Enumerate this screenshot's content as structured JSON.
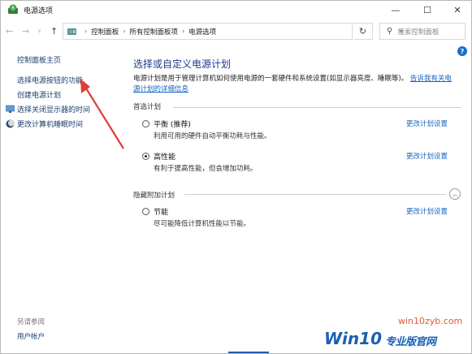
{
  "window": {
    "title": "电源选项",
    "min_glyph": "—",
    "max_glyph": "☐",
    "close_glyph": "✕"
  },
  "nav": {
    "back_glyph": "←",
    "forward_glyph": "→",
    "dropdown_glyph": "∨",
    "up_glyph": "↑",
    "breadcrumbs": [
      "控制面板",
      "所有控制面板项",
      "电源选项"
    ],
    "crumb_separator": "›",
    "refresh_glyph": "↻",
    "search_placeholder": "搜索控制面板",
    "search_glyph": "⚲"
  },
  "sidebar": {
    "home": "控制面板主页",
    "items": [
      {
        "label": "选择电源按钮的功能"
      },
      {
        "label": "创建电源计划"
      },
      {
        "label": "选择关闭显示器的时间"
      },
      {
        "label": "更改计算机睡眠时间"
      }
    ],
    "see_also": "另请参阅",
    "user_accounts": "用户帐户"
  },
  "main": {
    "heading": "选择或自定义电源计划",
    "desc_text": "电源计划是用于管理计算机如何使用电源的一套硬件和系统设置(如显示器亮度、睡眠等)。",
    "desc_link": "告诉我有关电源计划的详细信息",
    "preferred_label": "首选计划",
    "hidden_label": "隐藏附加计划",
    "plans": [
      {
        "name": "平衡 (推荐)",
        "desc": "利用可用的硬件自动平衡功耗与性能。",
        "selected": false,
        "link": "更改计划设置"
      },
      {
        "name": "高性能",
        "desc": "有利于提高性能，但会增加功耗。",
        "selected": true,
        "link": "更改计划设置"
      },
      {
        "name": "节能",
        "desc": "尽可能降低计算机性能以节能。",
        "selected": false,
        "link": "更改计划设置"
      }
    ],
    "collapse_glyph": "︿",
    "help_glyph": "?"
  },
  "watermark": {
    "url": "win10zyb.com",
    "logo": "Win10",
    "sub": "专业版官网"
  },
  "colors": {
    "heading": "#1e3a8a",
    "link": "#1565c0",
    "arrow": "#e53935",
    "watermark_blue": "#1a5fb4",
    "watermark_orange": "#e05a3a"
  }
}
